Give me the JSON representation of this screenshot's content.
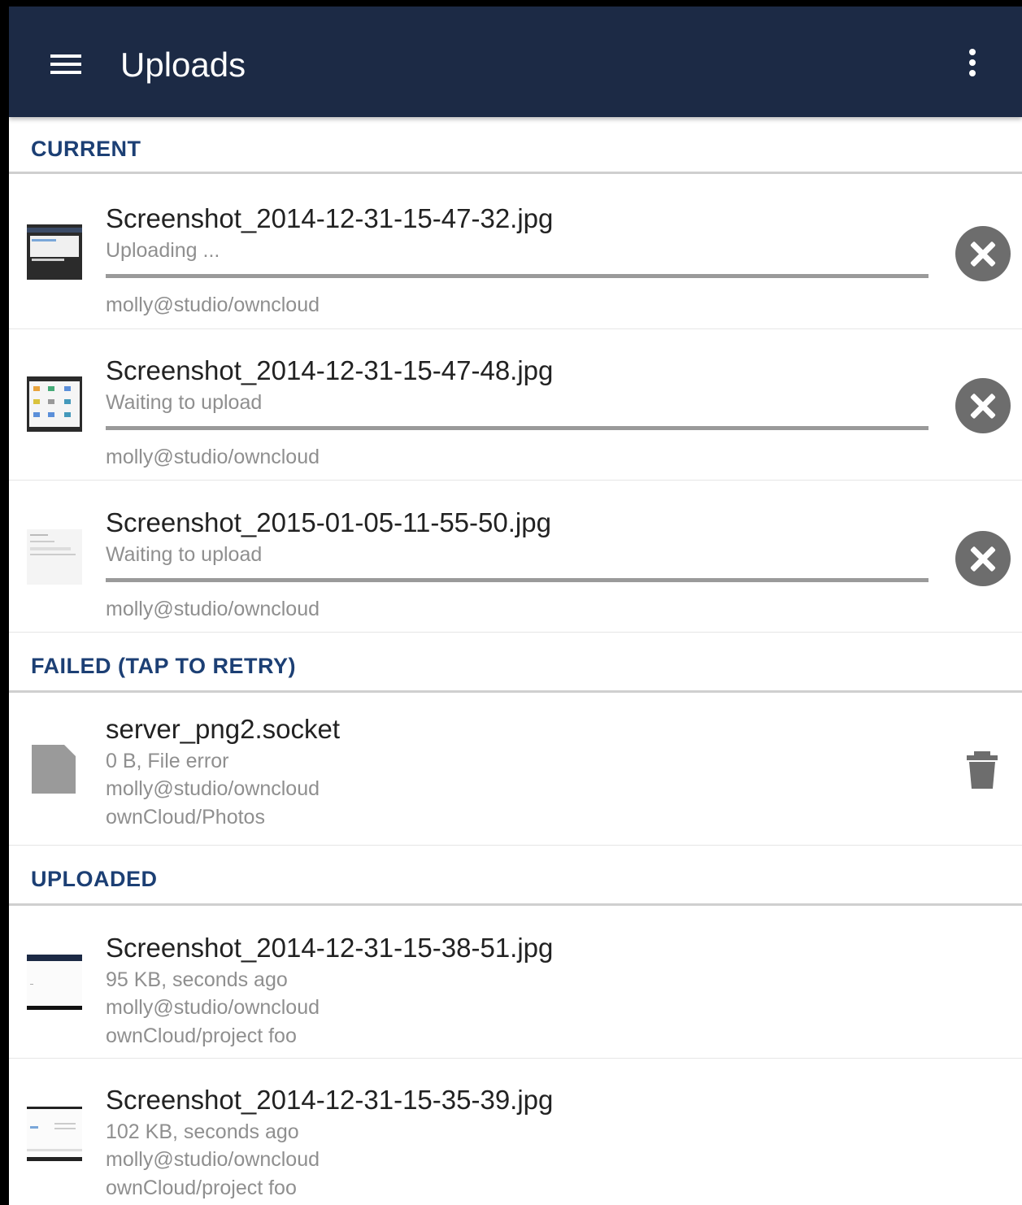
{
  "appbar": {
    "title": "Uploads",
    "menu_icon": "hamburger-menu-icon",
    "overflow_icon": "more-vertical-icon"
  },
  "colors": {
    "appbar": "#1c2a45",
    "section_title": "#1c3f74",
    "secondary_text": "#8f8f8f",
    "cancel_button": "#6d6d6d"
  },
  "sections": {
    "current": {
      "title": "CURRENT",
      "items": [
        {
          "name": "Screenshot_2014-12-31-15-47-32.jpg",
          "status": "Uploading ...",
          "account": "molly@studio/owncloud",
          "progress": 1.0,
          "action_icon": "cancel-icon"
        },
        {
          "name": "Screenshot_2014-12-31-15-47-48.jpg",
          "status": "Waiting to upload",
          "account": "molly@studio/owncloud",
          "progress": 1.0,
          "action_icon": "cancel-icon"
        },
        {
          "name": "Screenshot_2015-01-05-11-55-50.jpg",
          "status": "Waiting to upload",
          "account": "molly@studio/owncloud",
          "progress": 1.0,
          "action_icon": "cancel-icon"
        }
      ]
    },
    "failed": {
      "title": "FAILED (TAP TO RETRY)",
      "items": [
        {
          "name": "server_png2.socket",
          "status": "0 B, File error",
          "account": "molly@studio/owncloud",
          "path": "ownCloud/Photos",
          "file_icon": "generic-file-icon",
          "action_icon": "trash-icon"
        }
      ]
    },
    "uploaded": {
      "title": "UPLOADED",
      "items": [
        {
          "name": "Screenshot_2014-12-31-15-38-51.jpg",
          "status": "95 KB,  seconds ago",
          "account": "molly@studio/owncloud",
          "path": "ownCloud/project foo"
        },
        {
          "name": "Screenshot_2014-12-31-15-35-39.jpg",
          "status": "102 KB,  seconds ago",
          "account": "molly@studio/owncloud",
          "path": "ownCloud/project foo"
        }
      ]
    }
  }
}
